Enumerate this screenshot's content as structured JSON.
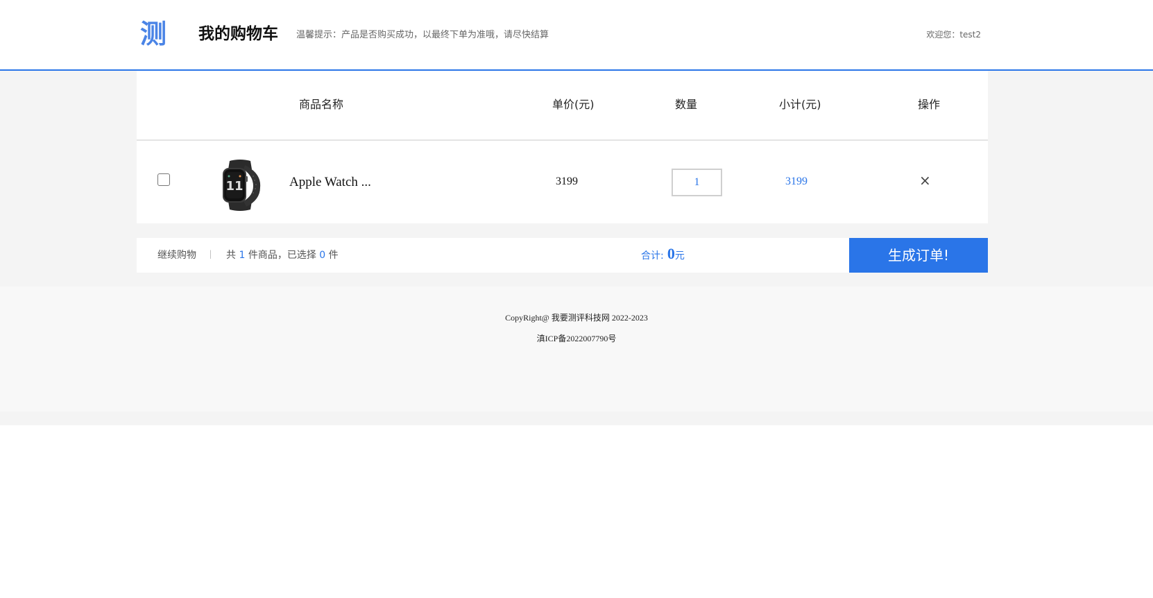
{
  "header": {
    "logo_char": "测",
    "title": "我的购物车",
    "tip": "温馨提示：产品是否购买成功，以最终下单为准哦，请尽快结算",
    "welcome": "欢迎您：test2"
  },
  "table": {
    "columns": {
      "name": "商品名称",
      "price": "单价(元)",
      "quantity": "数量",
      "subtotal": "小计(元)",
      "action": "操作"
    },
    "rows": [
      {
        "name": "Apple Watch ...",
        "price": "3199",
        "quantity": "1",
        "subtotal": "3199",
        "remove_glyph": "×",
        "image_icon": "smartwatch-image"
      }
    ]
  },
  "footer_bar": {
    "continue_label": "继续购物",
    "separator": "|",
    "count_prefix": "共",
    "count_total": "1",
    "count_mid": "件商品，已选择",
    "count_selected": "0",
    "count_suffix": "件",
    "total_label": "合计:",
    "total_amount": "0",
    "total_unit": "元",
    "submit_label": "生成订单!"
  },
  "page_footer": {
    "copyright": "CopyRight@ 我要测评科技网 2022-2023",
    "icp": "滇ICP备2022007790号"
  },
  "colors": {
    "accent": "#2a75e8",
    "logo": "#4a84e6"
  }
}
